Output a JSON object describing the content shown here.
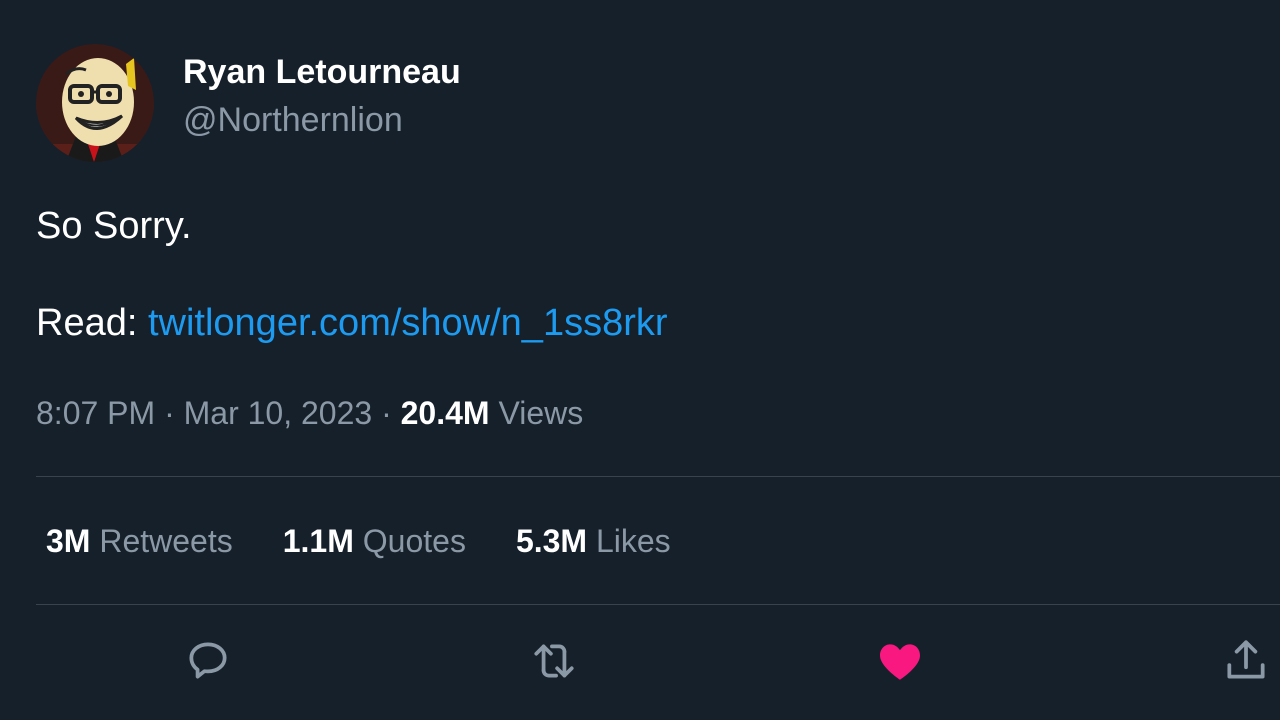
{
  "author": {
    "display_name": "Ryan Letourneau",
    "handle": "@Northernlion",
    "avatar_icon": "cartoon-face-avatar"
  },
  "tweet": {
    "text_line_1": "So Sorry.",
    "read_prefix": "Read: ",
    "link_text": "twitlonger.com/show/n_1ss8rkr"
  },
  "meta": {
    "time": "8:07 PM",
    "separator": " · ",
    "date": "Mar 10, 2023",
    "views_count": "20.4M",
    "views_label": " Views"
  },
  "stats": [
    {
      "count": "3M",
      "label": " Retweets"
    },
    {
      "count": "1.1M",
      "label": " Quotes"
    },
    {
      "count": "5.3M",
      "label": " Likes"
    }
  ],
  "actions": {
    "reply_icon": "reply-icon",
    "retweet_icon": "retweet-icon",
    "like_icon": "heart-icon",
    "share_icon": "share-icon",
    "liked": true
  },
  "colors": {
    "background": "#16202b",
    "link": "#1d9bf0",
    "like_active": "#f91880",
    "muted": "#8b98a5"
  }
}
